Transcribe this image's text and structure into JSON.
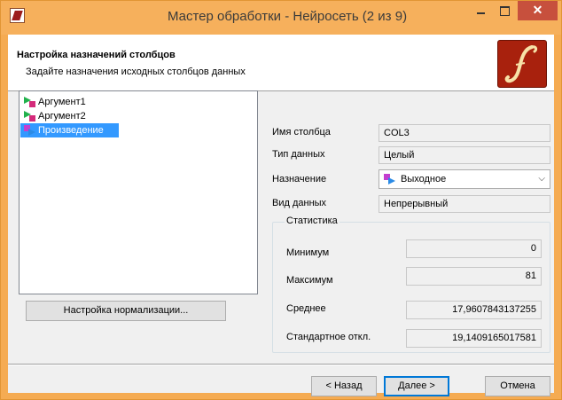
{
  "window": {
    "title": "Мастер обработки - Нейросеть (2 из 9)",
    "close_glyph": "✕"
  },
  "header": {
    "title": "Настройка назначений столбцов",
    "subtitle": "Задайте назначения исходных столбцов данных"
  },
  "columns": [
    {
      "label": "Аргумент1",
      "role": "input",
      "selected": false
    },
    {
      "label": "Аргумент2",
      "role": "input",
      "selected": false
    },
    {
      "label": "Произведение",
      "role": "output",
      "selected": true
    }
  ],
  "normalization_button": "Настройка нормализации...",
  "properties": {
    "column_name_label": "Имя столбца",
    "column_name_value": "COL3",
    "data_type_label": "Тип данных",
    "data_type_value": "Целый",
    "purpose_label": "Назначение",
    "purpose_value": "Выходное",
    "data_kind_label": "Вид данных",
    "data_kind_value": "Непрерывный"
  },
  "stats": {
    "legend": "Статистика",
    "min_label": "Минимум",
    "min_value": "0",
    "max_label": "Максимум",
    "max_value": "81",
    "mean_label": "Среднее",
    "mean_value": "17,9607843137255",
    "std_label": "Стандартное откл.",
    "std_value": "19,1409165017581"
  },
  "buttons": {
    "back": "< Назад",
    "next": "Далее >",
    "cancel": "Отмена"
  },
  "colors": {
    "title_bar": "#f6b05c",
    "selection": "#3399ff",
    "logo": "#a8210d"
  }
}
